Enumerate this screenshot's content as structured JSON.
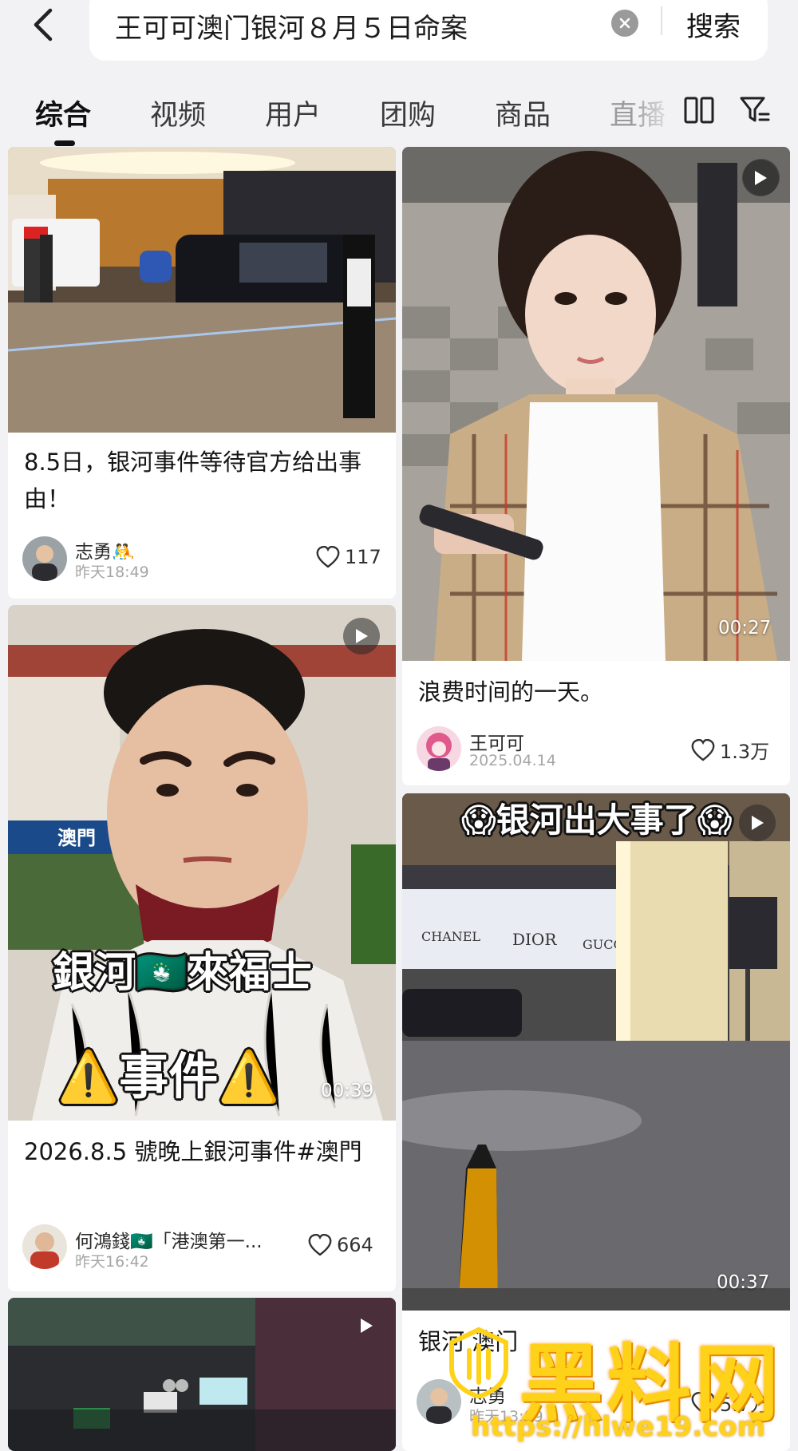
{
  "search": {
    "query": "王可可澳门银河８月５日命案",
    "submit_label": "搜索"
  },
  "tabs": [
    {
      "label": "综合",
      "active": true
    },
    {
      "label": "视频",
      "active": false
    },
    {
      "label": "用户",
      "active": false
    },
    {
      "label": "团购",
      "active": false
    },
    {
      "label": "商品",
      "active": false
    },
    {
      "label": "直播",
      "active": false
    }
  ],
  "icons": {
    "back": "back-arrow-icon",
    "clear": "clear-x-icon",
    "layout": "double-column-layout-icon",
    "filter": "filter-icon",
    "play": "play-icon",
    "like": "heart-icon"
  },
  "cards": [
    {
      "title": "8.5日，银河事件等待官方给出事由！",
      "author": "志勇🤼",
      "time": "昨天18:49",
      "likes": "117",
      "is_video": false
    },
    {
      "title": "浪费时间的一天。",
      "author": "王可可",
      "time": "2025.04.14",
      "likes": "1.3万",
      "duration": "00:27",
      "is_video": true
    },
    {
      "title": "2026.8.5 號晚上銀河事件#澳門",
      "author": "何鴻錢🇲🇴「港澳第一...",
      "time": "昨天16:42",
      "likes": "664",
      "duration": "00:39",
      "overlay_line1": "銀河🇲🇴來福士",
      "overlay_line2": "⚠️事件⚠️",
      "is_video": true
    },
    {
      "title": "银河出大事了",
      "overlay": "😱银河出大事了😱",
      "sign_text": [
        "CHANEL",
        "DIOR",
        "GUCCI"
      ],
      "duration": "00:37",
      "card_title": "银河 澳门",
      "author": "志勇",
      "time": "昨天13:09",
      "likes": "5.7万",
      "is_video": true
    },
    {
      "is_video": true
    }
  ],
  "watermark": {
    "brand": "黑料网",
    "url": "https://hlwe19.com"
  },
  "colors": {
    "background": "#f2f2f4",
    "card": "#ffffff",
    "watermark": "#ffd21a"
  }
}
